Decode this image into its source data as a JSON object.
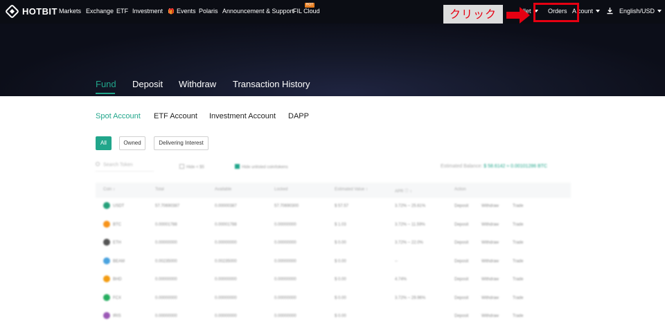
{
  "brand": {
    "logo_text": "HOTBIT"
  },
  "nav": {
    "markets": "Markets",
    "exchange": "Exchange",
    "etf": "ETF",
    "investment": "Investment",
    "events": "Events",
    "polaris": "Polaris",
    "announcement": "Announcement & Support",
    "fil_cloud": "FIL Cloud",
    "hot_badge": "HOT",
    "wallet": "llet",
    "orders": "Orders",
    "account": "A     count",
    "language": "English/USD"
  },
  "annotation": {
    "label": "クリック",
    "color": "#e60012"
  },
  "hero_tabs": [
    "Fund",
    "Deposit",
    "Withdraw",
    "Transaction History"
  ],
  "account_tabs": [
    "Spot Account",
    "ETF Account",
    "Investment Account",
    "DAPP"
  ],
  "filters": [
    "All",
    "Owned",
    "Delivering Interest"
  ],
  "toolbar": {
    "search_placeholder": "Search Token",
    "hide_small": "Hide < $5",
    "hide_unlisted": "Hide unlisted coin/tokens",
    "est_label": "Estimated Balance:",
    "est_value": "$ 58.6142 ≈ 0.00101286 BTC"
  },
  "table": {
    "headers": [
      "Coin ↕",
      "Total",
      "Available",
      "Locked",
      "Estimated Value ↕",
      "APR ⓘ ↕",
      "Action"
    ],
    "rows": [
      {
        "coin": "USDT",
        "icon_color": "#26a17b",
        "total": "57.70690387",
        "available": "0.00000387",
        "locked": "57.70690300",
        "value": "$ 57.57",
        "apr": "3.72% ~ 25.61%",
        "actions": [
          "Deposit",
          "Withdraw",
          "Trade"
        ]
      },
      {
        "coin": "BTC",
        "icon_color": "#f7931a",
        "total": "0.00001788",
        "available": "0.00001788",
        "locked": "0.00000000",
        "value": "$ 1.03",
        "apr": "3.72% ~ 11.59%",
        "actions": [
          "Deposit",
          "Withdraw",
          "Trade"
        ]
      },
      {
        "coin": "ETH",
        "icon_color": "#555555",
        "total": "0.00000000",
        "available": "0.00000000",
        "locked": "0.00000000",
        "value": "$ 0.00",
        "apr": "3.72% ~ 22.0%",
        "actions": [
          "Deposit",
          "Withdraw",
          "Trade"
        ]
      },
      {
        "coin": "BEAM",
        "icon_color": "#4aa3df",
        "total": "0.00235000",
        "available": "0.00235000",
        "locked": "0.00000000",
        "value": "$ 0.00",
        "apr": "--",
        "actions": [
          "Deposit",
          "Withdraw",
          "Trade"
        ]
      },
      {
        "coin": "BHD",
        "icon_color": "#f39c12",
        "total": "0.00000000",
        "available": "0.00000000",
        "locked": "0.00000000",
        "value": "$ 0.00",
        "apr": "4.74%",
        "actions": [
          "Deposit",
          "Withdraw",
          "Trade"
        ]
      },
      {
        "coin": "FCX",
        "icon_color": "#27ae60",
        "total": "0.00000000",
        "available": "0.00000000",
        "locked": "0.00000000",
        "value": "$ 0.00",
        "apr": "3.72% ~ 29.96%",
        "actions": [
          "Deposit",
          "Withdraw",
          "Trade"
        ]
      },
      {
        "coin": "IRIS",
        "icon_color": "#9b59b6",
        "total": "0.00000000",
        "available": "0.00000000",
        "locked": "0.00000000",
        "value": "$ 0.00",
        "apr": "",
        "actions": [
          "Deposit",
          "Withdraw",
          "Trade"
        ]
      }
    ]
  },
  "colors": {
    "accent": "#21a68b",
    "topbar": "#0b0d14",
    "annotation": "#e60012"
  }
}
